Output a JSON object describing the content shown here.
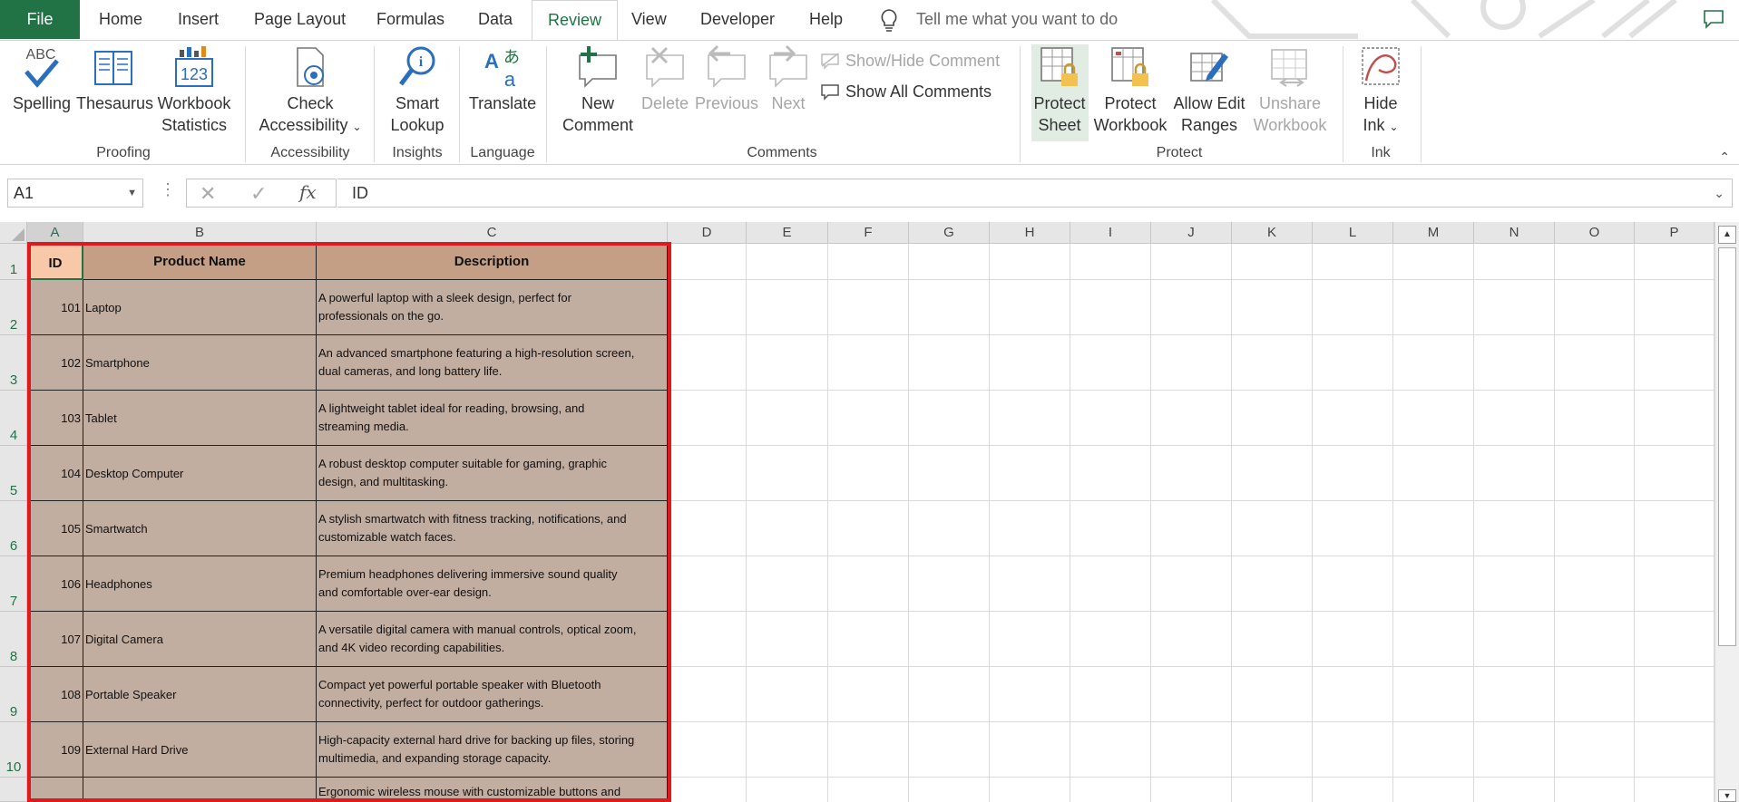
{
  "menu": {
    "tabs": [
      "File",
      "Home",
      "Insert",
      "Page Layout",
      "Formulas",
      "Data",
      "Review",
      "View",
      "Developer",
      "Help"
    ],
    "active_tab": "Review",
    "tell_me": "Tell me what you want to do"
  },
  "ribbon": {
    "spelling": "Spelling",
    "thesaurus": "Thesaurus",
    "workbook_statistics_1": "Workbook",
    "workbook_statistics_2": "Statistics",
    "proofing": "Proofing",
    "check_accessibility_1": "Check",
    "check_accessibility_2": "Accessibility",
    "accessibility": "Accessibility",
    "smart_lookup_1": "Smart",
    "smart_lookup_2": "Lookup",
    "insights": "Insights",
    "translate": "Translate",
    "language": "Language",
    "new_comment_1": "New",
    "new_comment_2": "Comment",
    "delete": "Delete",
    "previous": "Previous",
    "next": "Next",
    "show_hide_comment": "Show/Hide Comment",
    "show_all_comments": "Show All Comments",
    "comments": "Comments",
    "protect_sheet_1": "Protect",
    "protect_sheet_2": "Sheet",
    "protect_workbook_1": "Protect",
    "protect_workbook_2": "Workbook",
    "allow_edit_ranges_1": "Allow Edit",
    "allow_edit_ranges_2": "Ranges",
    "unshare_workbook_1": "Unshare",
    "unshare_workbook_2": "Workbook",
    "protect": "Protect",
    "hide_ink_1": "Hide",
    "hide_ink_2": "Ink",
    "ink": "Ink"
  },
  "formula_bar": {
    "name_box": "A1",
    "formula": "ID",
    "fx": "fx"
  },
  "grid": {
    "columns": [
      "A",
      "B",
      "C",
      "D",
      "E",
      "F",
      "G",
      "H",
      "I",
      "J",
      "K",
      "L",
      "M",
      "N",
      "O",
      "P"
    ],
    "rows": [
      "1",
      "2",
      "3",
      "4",
      "5",
      "6",
      "7",
      "8",
      "9",
      "10"
    ],
    "headers": [
      "ID",
      "Product Name",
      "Description"
    ],
    "data": [
      {
        "id": "101",
        "name": "Laptop",
        "desc1": "A powerful laptop with a sleek design, perfect for",
        "desc2": "professionals on the go."
      },
      {
        "id": "102",
        "name": "Smartphone",
        "desc1": "An advanced smartphone featuring a high-resolution screen,",
        "desc2": "dual cameras, and long battery life."
      },
      {
        "id": "103",
        "name": "Tablet",
        "desc1": "A lightweight tablet ideal for reading, browsing, and",
        "desc2": "streaming media."
      },
      {
        "id": "104",
        "name": "Desktop Computer",
        "desc1": "A robust desktop computer suitable for gaming, graphic",
        "desc2": "design, and multitasking."
      },
      {
        "id": "105",
        "name": "Smartwatch",
        "desc1": "A stylish smartwatch with fitness tracking, notifications, and",
        "desc2": "customizable watch faces."
      },
      {
        "id": "106",
        "name": "Headphones",
        "desc1": "Premium headphones delivering immersive sound quality",
        "desc2": "and comfortable over-ear design."
      },
      {
        "id": "107",
        "name": "Digital Camera",
        "desc1": "A versatile digital camera with manual controls, optical zoom,",
        "desc2": "and 4K video recording capabilities."
      },
      {
        "id": "108",
        "name": "Portable Speaker",
        "desc1": "Compact yet powerful portable speaker with Bluetooth",
        "desc2": "connectivity, perfect for outdoor gatherings."
      },
      {
        "id": "109",
        "name": "External Hard Drive",
        "desc1": "High-capacity external hard drive for backing up files, storing",
        "desc2": "multimedia, and expanding storage capacity."
      },
      {
        "id": "",
        "name": "",
        "desc1": "Ergonomic wireless mouse with customizable buttons and",
        "desc2": ""
      }
    ]
  },
  "colors": {
    "excel_green": "#217346",
    "header_fill": "#c49f86",
    "body_fill": "#c2ada1",
    "selection_box": "#e0191f"
  }
}
